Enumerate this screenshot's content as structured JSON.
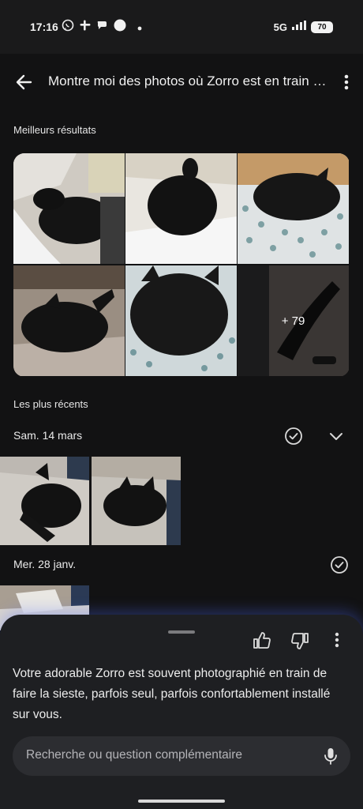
{
  "status": {
    "time": "17:16",
    "network": "5G",
    "battery": "70",
    "notif_icons": [
      "whatsapp-icon",
      "slack-icon",
      "chat-bubbles-icon",
      "circle-icon",
      "dot-icon"
    ]
  },
  "header": {
    "title": "Montre moi des photos où Zorro est en train de faire la sieste",
    "back_icon": "arrow-back-icon",
    "menu_icon": "more-vert-icon"
  },
  "sections": {
    "best": {
      "label": "Meilleurs résultats",
      "more_count": "+ 79"
    },
    "recent": {
      "label": "Les plus récents"
    }
  },
  "groups": [
    {
      "date": "Sam. 14 mars"
    },
    {
      "date": "Mer. 28 janv."
    }
  ],
  "sheet": {
    "answer": "Votre adorable Zorro est souvent photographié en train de faire la sieste, parfois seul, parfois confortablement installé sur vous.",
    "search_placeholder": "Recherche ou question complémentaire"
  },
  "colors": {
    "background": "#121213",
    "sheet": "#1e1f22",
    "accent_glow": "#506eff"
  }
}
